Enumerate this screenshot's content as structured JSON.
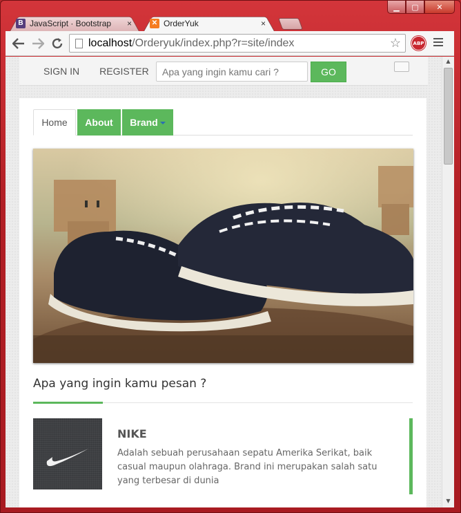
{
  "browser": {
    "tabs": [
      {
        "title": "JavaScript · Bootstrap",
        "favicon": "bootstrap-icon",
        "favicon_letter": "B",
        "active": false
      },
      {
        "title": "OrderYuk",
        "favicon": "xampp-icon",
        "favicon_letter": "✕",
        "active": true
      }
    ],
    "tab_close": "×",
    "url_host": "localhost",
    "url_path": "/Orderyuk/index.php?r=site/index",
    "window_buttons": {
      "minimize": "▁",
      "maximize": "▢",
      "close": "✕"
    }
  },
  "topbar": {
    "sign_in": "SIGN IN",
    "register": "REGISTER",
    "search_placeholder": "Apa yang ingin kamu cari ?",
    "go": "GO"
  },
  "nav": {
    "home": "Home",
    "about": "About",
    "brand": "Brand"
  },
  "section": {
    "title": "Apa yang ingin kamu pesan ?"
  },
  "brand_item": {
    "name": "NIKE",
    "description": "Adalah sebuah perusahaan sepatu Amerika Serikat, baik casual maupun olahraga. Brand ini merupakan salah satu yang terbesar di dunia",
    "logo": "nike-swoosh-icon"
  },
  "colors": {
    "accent": "#5cb85c",
    "window": "#b8272b"
  }
}
